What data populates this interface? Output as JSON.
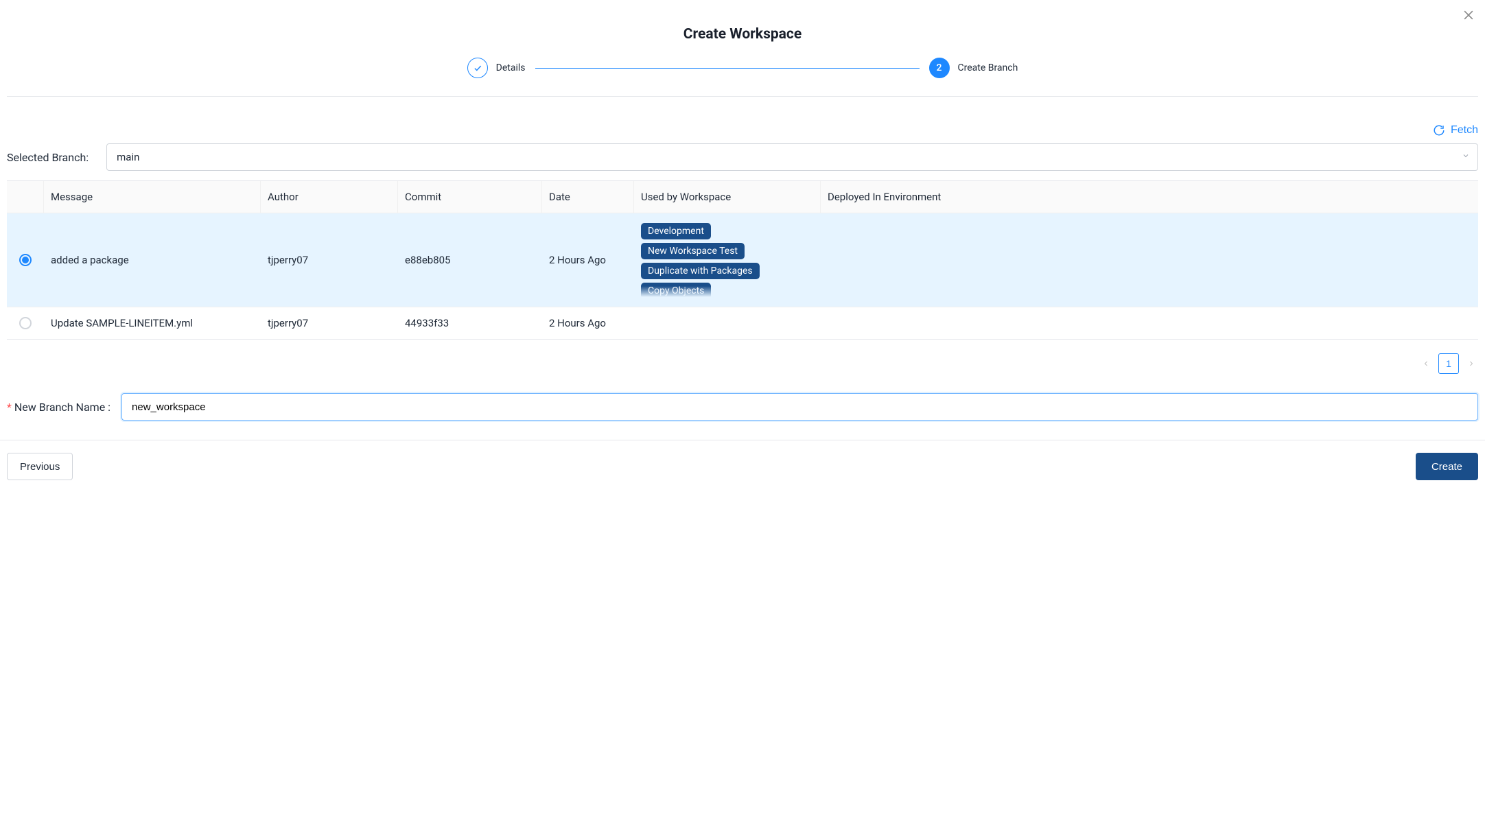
{
  "header": {
    "title": "Create Workspace"
  },
  "steps": {
    "step1_label": "Details",
    "step2_number": "2",
    "step2_label": "Create Branch"
  },
  "actions": {
    "fetch": "Fetch"
  },
  "selected_branch": {
    "label": "Selected Branch:",
    "value": "main"
  },
  "table": {
    "headers": {
      "message": "Message",
      "author": "Author",
      "commit": "Commit",
      "date": "Date",
      "workspace": "Used by Workspace",
      "environment": "Deployed In Environment"
    },
    "rows": [
      {
        "selected": true,
        "message": "added a package",
        "author": "tjperry07",
        "commit": "e88eb805",
        "date": "2 Hours Ago",
        "workspaces": [
          "Development",
          "New Workspace Test",
          "Duplicate with Packages",
          "Copy Objects"
        ],
        "environment": ""
      },
      {
        "selected": false,
        "message": "Update SAMPLE-LINEITEM.yml",
        "author": "tjperry07",
        "commit": "44933f33",
        "date": "2 Hours Ago",
        "workspaces": [],
        "environment": ""
      }
    ]
  },
  "pagination": {
    "current": "1"
  },
  "new_branch": {
    "label": "New Branch Name",
    "value": "new_workspace"
  },
  "footer": {
    "previous": "Previous",
    "create": "Create"
  }
}
